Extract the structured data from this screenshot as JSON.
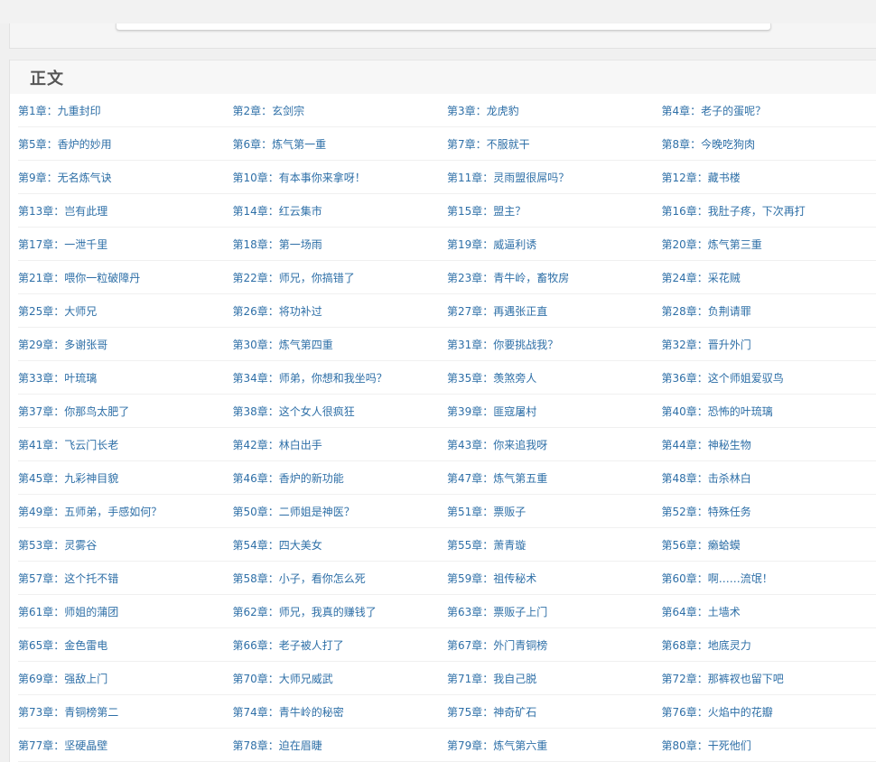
{
  "section": {
    "title": "正文"
  },
  "chapters": [
    "第1章：九重封印",
    "第2章：玄剑宗",
    "第3章：龙虎豹",
    "第4章：老子的蛋呢？",
    "第5章：香炉的妙用",
    "第6章：炼气第一重",
    "第7章：不服就干",
    "第8章：今晚吃狗肉",
    "第9章：无名炼气诀",
    "第10章：有本事你来拿呀！",
    "第11章：灵雨盟很屌吗？",
    "第12章：藏书楼",
    "第13章：岂有此理",
    "第14章：红云集市",
    "第15章：盟主？",
    "第16章：我肚子疼，下次再打",
    "第17章：一泄千里",
    "第18章：第一场雨",
    "第19章：威逼利诱",
    "第20章：炼气第三重",
    "第21章：喂你一粒破障丹",
    "第22章：师兄，你搞错了",
    "第23章：青牛岭，畜牧房",
    "第24章：采花贼",
    "第25章：大师兄",
    "第26章：将功补过",
    "第27章：再遇张正直",
    "第28章：负荆请罪",
    "第29章：多谢张哥",
    "第30章：炼气第四重",
    "第31章：你要挑战我？",
    "第32章：晋升外门",
    "第33章：叶琉璃",
    "第34章：师弟，你想和我坐吗？",
    "第35章：羡煞旁人",
    "第36章：这个师姐爱驭鸟",
    "第37章：你那鸟太肥了",
    "第38章：这个女人很疯狂",
    "第39章：匪寇屠村",
    "第40章：恐怖的叶琉璃",
    "第41章：飞云门长老",
    "第42章：林白出手",
    "第43章：你来追我呀",
    "第44章：神秘生物",
    "第45章：九彩神目貌",
    "第46章：香炉的新功能",
    "第47章：炼气第五重",
    "第48章：击杀林白",
    "第49章：五师弟，手感如何？",
    "第50章：二师姐是神医？",
    "第51章：票贩子",
    "第52章：特殊任务",
    "第53章：灵雾谷",
    "第54章：四大美女",
    "第55章：萧青璇",
    "第56章：癞蛤蟆",
    "第57章：这个托不错",
    "第58章：小子，看你怎么死",
    "第59章：祖传秘术",
    "第60章：啊……流氓！",
    "第61章：师姐的蒲团",
    "第62章：师兄，我真的赚钱了",
    "第63章：票贩子上门",
    "第64章：土墙术",
    "第65章：金色雷电",
    "第66章：老子被人打了",
    "第67章：外门青铜榜",
    "第68章：地底灵力",
    "第69章：强敌上门",
    "第70章：大师兄威武",
    "第71章：我自己脱",
    "第72章：那裤衩也留下吧",
    "第73章：青铜榜第二",
    "第74章：青牛岭的秘密",
    "第75章：神奇矿石",
    "第76章：火焰中的花瓣",
    "第77章：坚硬晶壁",
    "第78章：迫在眉睫",
    "第79章：炼气第六重",
    "第80章：干死他们"
  ]
}
